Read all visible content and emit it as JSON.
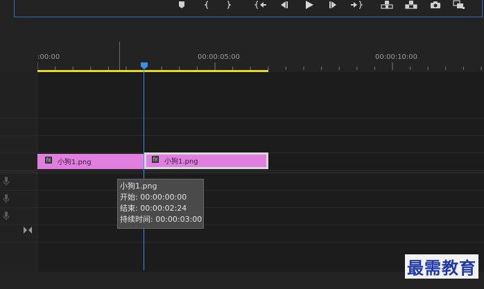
{
  "transport": {
    "buttons": [
      {
        "name": "add-marker-icon"
      },
      {
        "name": "mark-in-icon"
      },
      {
        "name": "mark-out-icon"
      },
      {
        "name": "go-to-in-icon"
      },
      {
        "name": "step-back-icon"
      },
      {
        "name": "play-icon"
      },
      {
        "name": "step-forward-icon"
      },
      {
        "name": "go-to-out-icon"
      },
      {
        "name": "lift-icon"
      },
      {
        "name": "extract-icon"
      },
      {
        "name": "export-frame-icon"
      },
      {
        "name": "button-editor-icon"
      }
    ]
  },
  "ruler": {
    "labels": [
      ":00:00",
      "00:00:05:00",
      "00:00:10:00"
    ]
  },
  "clips": [
    {
      "label": "小狗1.png",
      "selected": false
    },
    {
      "label": "小狗1.png",
      "selected": true
    }
  ],
  "tooltip": {
    "name": "小狗1.png",
    "start": "开始: 00:00:00:00",
    "end": "结束: 00:00:02:24",
    "duration": "持续时间: 00:00:03:00"
  },
  "colors": {
    "clip": "#e07fe0",
    "playhead": "#3a8ee6",
    "work_area": "#e6d92a"
  },
  "watermark": "最需教育"
}
